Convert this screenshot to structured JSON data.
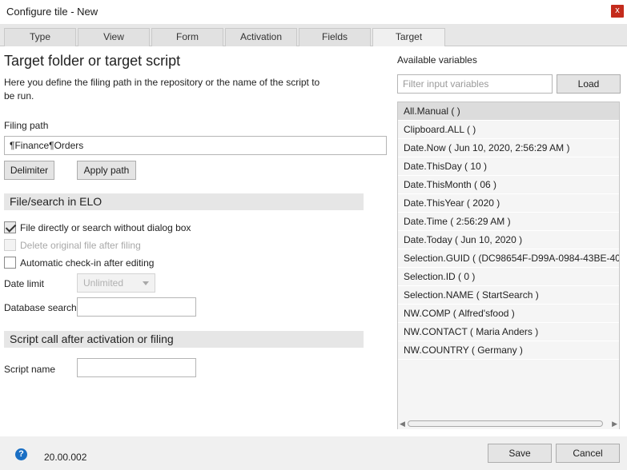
{
  "window": {
    "title": "Configure tile - New",
    "close_glyph": "x"
  },
  "tabs": [
    {
      "label": "Type"
    },
    {
      "label": "View"
    },
    {
      "label": "Form"
    },
    {
      "label": "Activation"
    },
    {
      "label": "Fields"
    },
    {
      "label": "Target",
      "active": true
    }
  ],
  "target": {
    "heading": "Target folder or target script",
    "description": "Here you define the filing path in the repository or the name of the script to be run.",
    "filing_path_label": "Filing path",
    "filing_path_value": "¶Finance¶Orders",
    "delimiter_button": "Delimiter",
    "apply_path_button": "Apply path"
  },
  "file_search": {
    "section_title": "File/search in ELO",
    "file_directly_label": "File directly or search without dialog box",
    "file_directly_checked": true,
    "delete_original_label": "Delete original file after filing",
    "delete_original_checked": false,
    "auto_checkin_label": "Automatic check-in after editing",
    "auto_checkin_checked": false,
    "date_limit_label": "Date limit",
    "date_limit_value": "Unlimited",
    "database_search_label": "Database search",
    "database_search_value": ""
  },
  "script_call": {
    "section_title": "Script call after activation or filing",
    "script_name_label": "Script name",
    "script_name_value": ""
  },
  "variables": {
    "title": "Available variables",
    "filter_placeholder": "Filter input variables",
    "load_button": "Load",
    "items": [
      "All.Manual ( )",
      "Clipboard.ALL ( )",
      "Date.Now ( Jun 10, 2020, 2:56:29 AM )",
      "Date.ThisDay ( 10 )",
      "Date.ThisMonth ( 06 )",
      "Date.ThisYear ( 2020 )",
      "Date.Time ( 2:56:29 AM )",
      "Date.Today ( Jun 10, 2020 )",
      "Selection.GUID ( (DC98654F-D99A-0984-43BE-40...",
      "Selection.ID ( 0 )",
      "Selection.NAME ( StartSearch )",
      "NW.COMP ( Alfred'sfood )",
      "NW.CONTACT ( Maria Anders )",
      "NW.COUNTRY ( Germany )"
    ]
  },
  "footer": {
    "help_glyph": "?",
    "version": "20.00.002",
    "save_button": "Save",
    "cancel_button": "Cancel"
  },
  "icons": {
    "help": "help-icon",
    "close": "close-icon",
    "checkmark": "checkmark-icon",
    "dropdown": "chevron-down-icon"
  },
  "colors": {
    "close_button": "#c42b1c",
    "help_icon": "#1a6fc4",
    "selected_item": "#dcdcdc"
  }
}
